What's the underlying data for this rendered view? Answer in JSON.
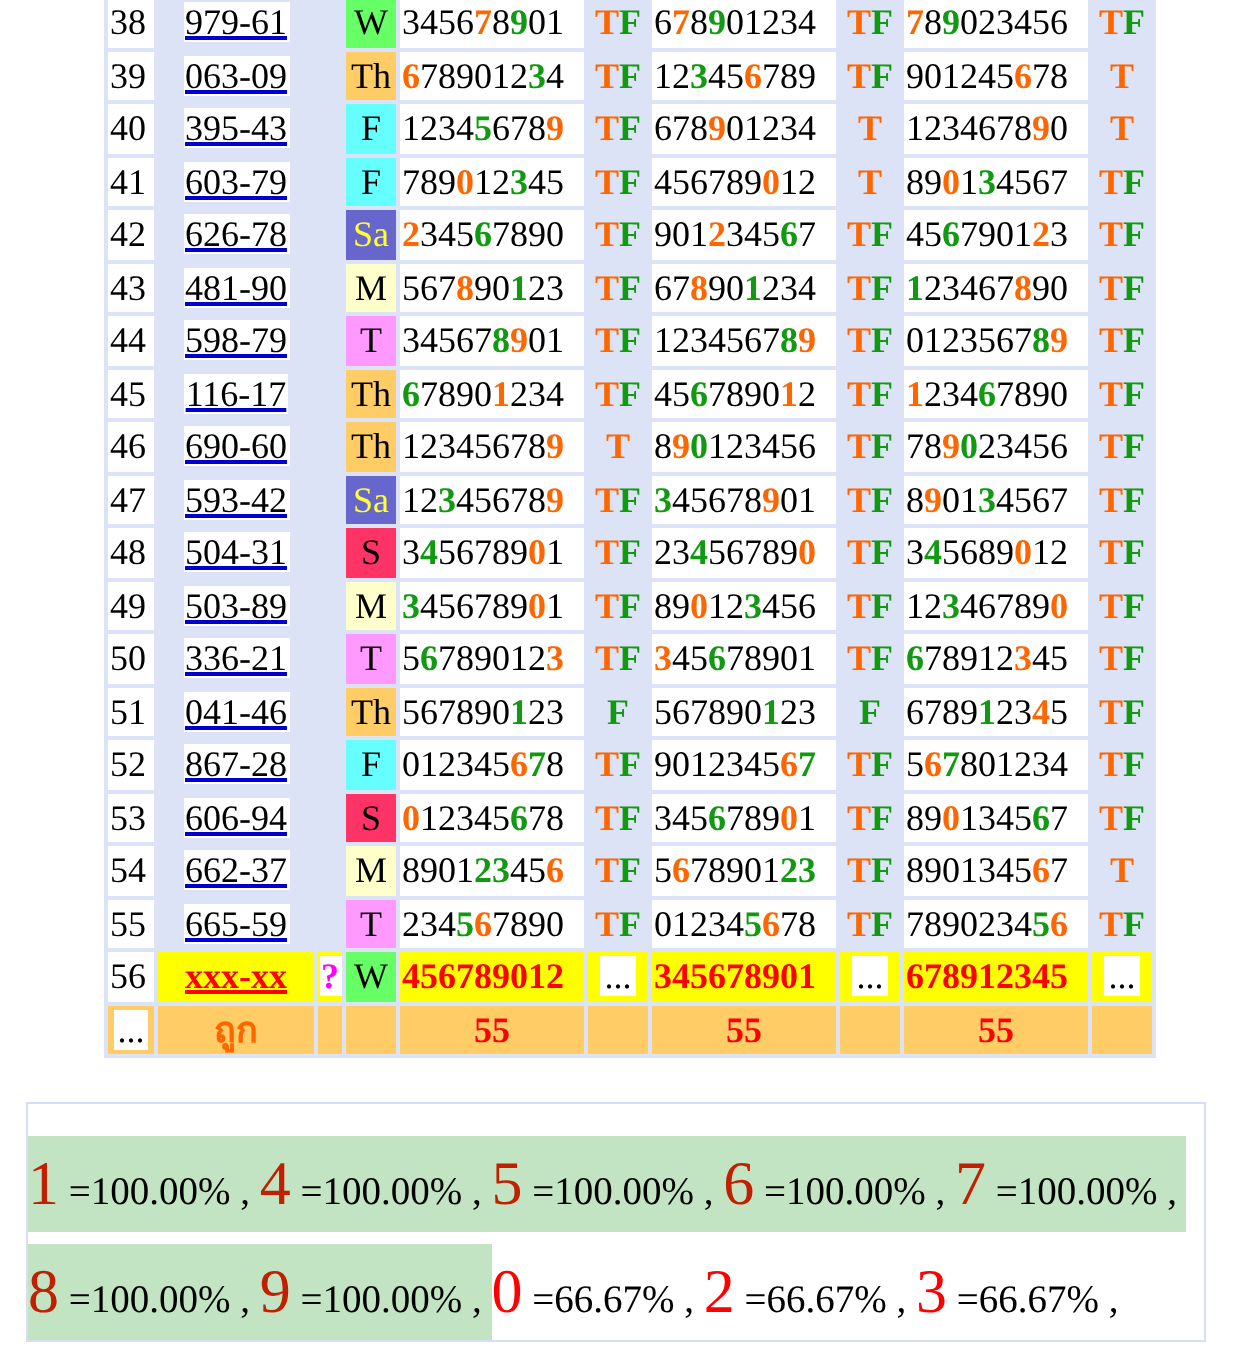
{
  "rows": [
    {
      "num": "38",
      "id": "979-61",
      "day": {
        "label": "W",
        "color": "#66ff66"
      },
      "draws": [
        {
          "digits": [
            {
              "text": "3456"
            },
            {
              "text": "7",
              "color": "#ff6600"
            },
            {
              "text": "8"
            },
            {
              "text": "9",
              "color": "#119911"
            },
            {
              "text": "01"
            }
          ],
          "result": [
            {
              "text": "T",
              "color": "#ff6600"
            },
            {
              "text": "F",
              "color": "#119911"
            }
          ]
        },
        {
          "digits": [
            {
              "text": "6"
            },
            {
              "text": "7",
              "color": "#ff6600"
            },
            {
              "text": "8"
            },
            {
              "text": "9",
              "color": "#119911"
            },
            {
              "text": "01234"
            }
          ],
          "result": [
            {
              "text": "T",
              "color": "#ff6600"
            },
            {
              "text": "F",
              "color": "#119911"
            }
          ]
        },
        {
          "digits": [
            {
              "text": "7",
              "color": "#ff6600"
            },
            {
              "text": "8"
            },
            {
              "text": "9",
              "color": "#119911"
            },
            {
              "text": "023456"
            }
          ],
          "result": [
            {
              "text": "T",
              "color": "#ff6600"
            },
            {
              "text": "F",
              "color": "#119911"
            }
          ]
        }
      ]
    },
    {
      "num": "39",
      "id": "063-09",
      "day": {
        "label": "Th",
        "color": "#ffcc66"
      },
      "draws": [
        {
          "digits": [
            {
              "text": "6",
              "color": "#ff6600"
            },
            {
              "text": "789012"
            },
            {
              "text": "3",
              "color": "#119911"
            },
            {
              "text": "4"
            }
          ],
          "result": [
            {
              "text": "T",
              "color": "#ff6600"
            },
            {
              "text": "F",
              "color": "#119911"
            }
          ]
        },
        {
          "digits": [
            {
              "text": "12"
            },
            {
              "text": "3",
              "color": "#119911"
            },
            {
              "text": "45"
            },
            {
              "text": "6",
              "color": "#ff6600"
            },
            {
              "text": "789"
            }
          ],
          "result": [
            {
              "text": "T",
              "color": "#ff6600"
            },
            {
              "text": "F",
              "color": "#119911"
            }
          ]
        },
        {
          "digits": [
            {
              "text": "901245"
            },
            {
              "text": "6",
              "color": "#ff6600"
            },
            {
              "text": "78"
            }
          ],
          "result": [
            {
              "text": "T",
              "color": "#ff6600"
            }
          ]
        }
      ]
    },
    {
      "num": "40",
      "id": "395-43",
      "day": {
        "label": "F",
        "color": "#66ffff"
      },
      "draws": [
        {
          "digits": [
            {
              "text": "1234"
            },
            {
              "text": "5",
              "color": "#119911"
            },
            {
              "text": "678"
            },
            {
              "text": "9",
              "color": "#ff6600"
            }
          ],
          "result": [
            {
              "text": "T",
              "color": "#ff6600"
            },
            {
              "text": "F",
              "color": "#119911"
            }
          ]
        },
        {
          "digits": [
            {
              "text": "678"
            },
            {
              "text": "9",
              "color": "#ff6600"
            },
            {
              "text": "01234"
            }
          ],
          "result": [
            {
              "text": "T",
              "color": "#ff6600"
            }
          ]
        },
        {
          "digits": [
            {
              "text": "1234678"
            },
            {
              "text": "9",
              "color": "#ff6600"
            },
            {
              "text": "0"
            }
          ],
          "result": [
            {
              "text": "T",
              "color": "#ff6600"
            }
          ]
        }
      ]
    },
    {
      "num": "41",
      "id": "603-79",
      "day": {
        "label": "F",
        "color": "#66ffff"
      },
      "draws": [
        {
          "digits": [
            {
              "text": "789"
            },
            {
              "text": "0",
              "color": "#ff6600"
            },
            {
              "text": "12"
            },
            {
              "text": "3",
              "color": "#119911"
            },
            {
              "text": "45"
            }
          ],
          "result": [
            {
              "text": "T",
              "color": "#ff6600"
            },
            {
              "text": "F",
              "color": "#119911"
            }
          ]
        },
        {
          "digits": [
            {
              "text": "456789"
            },
            {
              "text": "0",
              "color": "#ff6600"
            },
            {
              "text": "12"
            }
          ],
          "result": [
            {
              "text": "T",
              "color": "#ff6600"
            }
          ]
        },
        {
          "digits": [
            {
              "text": "89"
            },
            {
              "text": "0",
              "color": "#ff6600"
            },
            {
              "text": "1"
            },
            {
              "text": "3",
              "color": "#119911"
            },
            {
              "text": "4567"
            }
          ],
          "result": [
            {
              "text": "T",
              "color": "#ff6600"
            },
            {
              "text": "F",
              "color": "#119911"
            }
          ]
        }
      ]
    },
    {
      "num": "42",
      "id": "626-78",
      "day": {
        "label": "Sa",
        "color": "#6666cc"
      },
      "draws": [
        {
          "digits": [
            {
              "text": "2",
              "color": "#ff6600"
            },
            {
              "text": "345"
            },
            {
              "text": "6",
              "color": "#119911"
            },
            {
              "text": "7890"
            }
          ],
          "result": [
            {
              "text": "T",
              "color": "#ff6600"
            },
            {
              "text": "F",
              "color": "#119911"
            }
          ]
        },
        {
          "digits": [
            {
              "text": "901"
            },
            {
              "text": "2",
              "color": "#ff6600"
            },
            {
              "text": "345"
            },
            {
              "text": "6",
              "color": "#119911"
            },
            {
              "text": "7"
            }
          ],
          "result": [
            {
              "text": "T",
              "color": "#ff6600"
            },
            {
              "text": "F",
              "color": "#119911"
            }
          ]
        },
        {
          "digits": [
            {
              "text": "45"
            },
            {
              "text": "6",
              "color": "#119911"
            },
            {
              "text": "7901"
            },
            {
              "text": "2",
              "color": "#ff6600"
            },
            {
              "text": "3"
            }
          ],
          "result": [
            {
              "text": "T",
              "color": "#ff6600"
            },
            {
              "text": "F",
              "color": "#119911"
            }
          ]
        }
      ]
    },
    {
      "num": "43",
      "id": "481-90",
      "day": {
        "label": "M",
        "color": "#ffffcc"
      },
      "draws": [
        {
          "digits": [
            {
              "text": "567"
            },
            {
              "text": "8",
              "color": "#ff6600"
            },
            {
              "text": "90"
            },
            {
              "text": "1",
              "color": "#119911"
            },
            {
              "text": "23"
            }
          ],
          "result": [
            {
              "text": "T",
              "color": "#ff6600"
            },
            {
              "text": "F",
              "color": "#119911"
            }
          ]
        },
        {
          "digits": [
            {
              "text": "67"
            },
            {
              "text": "8",
              "color": "#ff6600"
            },
            {
              "text": "90"
            },
            {
              "text": "1",
              "color": "#119911"
            },
            {
              "text": "234"
            }
          ],
          "result": [
            {
              "text": "T",
              "color": "#ff6600"
            },
            {
              "text": "F",
              "color": "#119911"
            }
          ]
        },
        {
          "digits": [
            {
              "text": "1",
              "color": "#119911"
            },
            {
              "text": "23467"
            },
            {
              "text": "8",
              "color": "#ff6600"
            },
            {
              "text": "90"
            }
          ],
          "result": [
            {
              "text": "T",
              "color": "#ff6600"
            },
            {
              "text": "F",
              "color": "#119911"
            }
          ]
        }
      ]
    },
    {
      "num": "44",
      "id": "598-79",
      "day": {
        "label": "T",
        "color": "#ff99ff"
      },
      "draws": [
        {
          "digits": [
            {
              "text": "34567"
            },
            {
              "text": "8",
              "color": "#119911"
            },
            {
              "text": "9",
              "color": "#ff6600"
            },
            {
              "text": "01"
            }
          ],
          "result": [
            {
              "text": "T",
              "color": "#ff6600"
            },
            {
              "text": "F",
              "color": "#119911"
            }
          ]
        },
        {
          "digits": [
            {
              "text": "1234567"
            },
            {
              "text": "8",
              "color": "#119911"
            },
            {
              "text": "9",
              "color": "#ff6600"
            }
          ],
          "result": [
            {
              "text": "T",
              "color": "#ff6600"
            },
            {
              "text": "F",
              "color": "#119911"
            }
          ]
        },
        {
          "digits": [
            {
              "text": "0123567"
            },
            {
              "text": "8",
              "color": "#119911"
            },
            {
              "text": "9",
              "color": "#ff6600"
            }
          ],
          "result": [
            {
              "text": "T",
              "color": "#ff6600"
            },
            {
              "text": "F",
              "color": "#119911"
            }
          ]
        }
      ]
    },
    {
      "num": "45",
      "id": "116-17",
      "day": {
        "label": "Th",
        "color": "#ffcc66"
      },
      "draws": [
        {
          "digits": [
            {
              "text": "6",
              "color": "#119911"
            },
            {
              "text": "7890"
            },
            {
              "text": "1",
              "color": "#ff6600"
            },
            {
              "text": "234"
            }
          ],
          "result": [
            {
              "text": "T",
              "color": "#ff6600"
            },
            {
              "text": "F",
              "color": "#119911"
            }
          ]
        },
        {
          "digits": [
            {
              "text": "45"
            },
            {
              "text": "6",
              "color": "#119911"
            },
            {
              "text": "7890"
            },
            {
              "text": "1",
              "color": "#ff6600"
            },
            {
              "text": "2"
            }
          ],
          "result": [
            {
              "text": "T",
              "color": "#ff6600"
            },
            {
              "text": "F",
              "color": "#119911"
            }
          ]
        },
        {
          "digits": [
            {
              "text": "1",
              "color": "#ff6600"
            },
            {
              "text": "234"
            },
            {
              "text": "6",
              "color": "#119911"
            },
            {
              "text": "7890"
            }
          ],
          "result": [
            {
              "text": "T",
              "color": "#ff6600"
            },
            {
              "text": "F",
              "color": "#119911"
            }
          ]
        }
      ]
    },
    {
      "num": "46",
      "id": "690-60",
      "day": {
        "label": "Th",
        "color": "#ffcc66"
      },
      "draws": [
        {
          "digits": [
            {
              "text": "12345678"
            },
            {
              "text": "9",
              "color": "#ff6600"
            }
          ],
          "result": [
            {
              "text": "T",
              "color": "#ff6600"
            }
          ]
        },
        {
          "digits": [
            {
              "text": "8"
            },
            {
              "text": "9",
              "color": "#ff6600"
            },
            {
              "text": "0",
              "color": "#119911"
            },
            {
              "text": "123456"
            }
          ],
          "result": [
            {
              "text": "T",
              "color": "#ff6600"
            },
            {
              "text": "F",
              "color": "#119911"
            }
          ]
        },
        {
          "digits": [
            {
              "text": "78"
            },
            {
              "text": "9",
              "color": "#ff6600"
            },
            {
              "text": "0",
              "color": "#119911"
            },
            {
              "text": "23456"
            }
          ],
          "result": [
            {
              "text": "T",
              "color": "#ff6600"
            },
            {
              "text": "F",
              "color": "#119911"
            }
          ]
        }
      ]
    },
    {
      "num": "47",
      "id": "593-42",
      "day": {
        "label": "Sa",
        "color": "#6666cc"
      },
      "draws": [
        {
          "digits": [
            {
              "text": "12"
            },
            {
              "text": "3",
              "color": "#119911"
            },
            {
              "text": "45678"
            },
            {
              "text": "9",
              "color": "#ff6600"
            }
          ],
          "result": [
            {
              "text": "T",
              "color": "#ff6600"
            },
            {
              "text": "F",
              "color": "#119911"
            }
          ]
        },
        {
          "digits": [
            {
              "text": "3",
              "color": "#119911"
            },
            {
              "text": "45678"
            },
            {
              "text": "9",
              "color": "#ff6600"
            },
            {
              "text": "01"
            }
          ],
          "result": [
            {
              "text": "T",
              "color": "#ff6600"
            },
            {
              "text": "F",
              "color": "#119911"
            }
          ]
        },
        {
          "digits": [
            {
              "text": "8"
            },
            {
              "text": "9",
              "color": "#ff6600"
            },
            {
              "text": "01"
            },
            {
              "text": "3",
              "color": "#119911"
            },
            {
              "text": "4567"
            }
          ],
          "result": [
            {
              "text": "T",
              "color": "#ff6600"
            },
            {
              "text": "F",
              "color": "#119911"
            }
          ]
        }
      ]
    },
    {
      "num": "48",
      "id": "504-31",
      "day": {
        "label": "S",
        "color": "#ff3366"
      },
      "draws": [
        {
          "digits": [
            {
              "text": "3"
            },
            {
              "text": "4",
              "color": "#119911"
            },
            {
              "text": "56789"
            },
            {
              "text": "0",
              "color": "#ff6600"
            },
            {
              "text": "1"
            }
          ],
          "result": [
            {
              "text": "T",
              "color": "#ff6600"
            },
            {
              "text": "F",
              "color": "#119911"
            }
          ]
        },
        {
          "digits": [
            {
              "text": "23"
            },
            {
              "text": "4",
              "color": "#119911"
            },
            {
              "text": "56789"
            },
            {
              "text": "0",
              "color": "#ff6600"
            }
          ],
          "result": [
            {
              "text": "T",
              "color": "#ff6600"
            },
            {
              "text": "F",
              "color": "#119911"
            }
          ]
        },
        {
          "digits": [
            {
              "text": "3"
            },
            {
              "text": "4",
              "color": "#119911"
            },
            {
              "text": "5689"
            },
            {
              "text": "0",
              "color": "#ff6600"
            },
            {
              "text": "12"
            }
          ],
          "result": [
            {
              "text": "T",
              "color": "#ff6600"
            },
            {
              "text": "F",
              "color": "#119911"
            }
          ]
        }
      ]
    },
    {
      "num": "49",
      "id": "503-89",
      "day": {
        "label": "M",
        "color": "#ffffcc"
      },
      "draws": [
        {
          "digits": [
            {
              "text": "3",
              "color": "#119911"
            },
            {
              "text": "456789"
            },
            {
              "text": "0",
              "color": "#ff6600"
            },
            {
              "text": "1"
            }
          ],
          "result": [
            {
              "text": "T",
              "color": "#ff6600"
            },
            {
              "text": "F",
              "color": "#119911"
            }
          ]
        },
        {
          "digits": [
            {
              "text": "89"
            },
            {
              "text": "0",
              "color": "#ff6600"
            },
            {
              "text": "12"
            },
            {
              "text": "3",
              "color": "#119911"
            },
            {
              "text": "456"
            }
          ],
          "result": [
            {
              "text": "T",
              "color": "#ff6600"
            },
            {
              "text": "F",
              "color": "#119911"
            }
          ]
        },
        {
          "digits": [
            {
              "text": "12"
            },
            {
              "text": "3",
              "color": "#119911"
            },
            {
              "text": "46789"
            },
            {
              "text": "0",
              "color": "#ff6600"
            }
          ],
          "result": [
            {
              "text": "T",
              "color": "#ff6600"
            },
            {
              "text": "F",
              "color": "#119911"
            }
          ]
        }
      ]
    },
    {
      "num": "50",
      "id": "336-21",
      "day": {
        "label": "T",
        "color": "#ff99ff"
      },
      "draws": [
        {
          "digits": [
            {
              "text": "5"
            },
            {
              "text": "6",
              "color": "#119911"
            },
            {
              "text": "789012"
            },
            {
              "text": "3",
              "color": "#ff6600"
            }
          ],
          "result": [
            {
              "text": "T",
              "color": "#ff6600"
            },
            {
              "text": "F",
              "color": "#119911"
            }
          ]
        },
        {
          "digits": [
            {
              "text": "3",
              "color": "#ff6600"
            },
            {
              "text": "45"
            },
            {
              "text": "6",
              "color": "#119911"
            },
            {
              "text": "78901"
            }
          ],
          "result": [
            {
              "text": "T",
              "color": "#ff6600"
            },
            {
              "text": "F",
              "color": "#119911"
            }
          ]
        },
        {
          "digits": [
            {
              "text": "6",
              "color": "#119911"
            },
            {
              "text": "78912"
            },
            {
              "text": "3",
              "color": "#ff6600"
            },
            {
              "text": "45"
            }
          ],
          "result": [
            {
              "text": "T",
              "color": "#ff6600"
            },
            {
              "text": "F",
              "color": "#119911"
            }
          ]
        }
      ]
    },
    {
      "num": "51",
      "id": "041-46",
      "day": {
        "label": "Th",
        "color": "#ffcc66"
      },
      "draws": [
        {
          "digits": [
            {
              "text": "567890"
            },
            {
              "text": "1",
              "color": "#119911"
            },
            {
              "text": "23"
            }
          ],
          "result": [
            {
              "text": "F",
              "color": "#119911"
            }
          ]
        },
        {
          "digits": [
            {
              "text": "567890"
            },
            {
              "text": "1",
              "color": "#119911"
            },
            {
              "text": "23"
            }
          ],
          "result": [
            {
              "text": "F",
              "color": "#119911"
            }
          ]
        },
        {
          "digits": [
            {
              "text": "6789"
            },
            {
              "text": "1",
              "color": "#119911"
            },
            {
              "text": "23"
            },
            {
              "text": "4",
              "color": "#ff6600"
            },
            {
              "text": "5"
            }
          ],
          "result": [
            {
              "text": "T",
              "color": "#ff6600"
            },
            {
              "text": "F",
              "color": "#119911"
            }
          ]
        }
      ]
    },
    {
      "num": "52",
      "id": "867-28",
      "day": {
        "label": "F",
        "color": "#66ffff"
      },
      "draws": [
        {
          "digits": [
            {
              "text": "012345"
            },
            {
              "text": "6",
              "color": "#ff6600"
            },
            {
              "text": "7",
              "color": "#119911"
            },
            {
              "text": "8"
            }
          ],
          "result": [
            {
              "text": "T",
              "color": "#ff6600"
            },
            {
              "text": "F",
              "color": "#119911"
            }
          ]
        },
        {
          "digits": [
            {
              "text": "9012345"
            },
            {
              "text": "6",
              "color": "#ff6600"
            },
            {
              "text": "7",
              "color": "#119911"
            }
          ],
          "result": [
            {
              "text": "T",
              "color": "#ff6600"
            },
            {
              "text": "F",
              "color": "#119911"
            }
          ]
        },
        {
          "digits": [
            {
              "text": "5"
            },
            {
              "text": "6",
              "color": "#ff6600"
            },
            {
              "text": "7",
              "color": "#119911"
            },
            {
              "text": "801234"
            }
          ],
          "result": [
            {
              "text": "T",
              "color": "#ff6600"
            },
            {
              "text": "F",
              "color": "#119911"
            }
          ]
        }
      ]
    },
    {
      "num": "53",
      "id": "606-94",
      "day": {
        "label": "S",
        "color": "#ff3366"
      },
      "draws": [
        {
          "digits": [
            {
              "text": "0",
              "color": "#ff6600"
            },
            {
              "text": "12345"
            },
            {
              "text": "6",
              "color": "#119911"
            },
            {
              "text": "78"
            }
          ],
          "result": [
            {
              "text": "T",
              "color": "#ff6600"
            },
            {
              "text": "F",
              "color": "#119911"
            }
          ]
        },
        {
          "digits": [
            {
              "text": "345"
            },
            {
              "text": "6",
              "color": "#119911"
            },
            {
              "text": "789"
            },
            {
              "text": "0",
              "color": "#ff6600"
            },
            {
              "text": "1"
            }
          ],
          "result": [
            {
              "text": "T",
              "color": "#ff6600"
            },
            {
              "text": "F",
              "color": "#119911"
            }
          ]
        },
        {
          "digits": [
            {
              "text": "89"
            },
            {
              "text": "0",
              "color": "#ff6600"
            },
            {
              "text": "1345"
            },
            {
              "text": "6",
              "color": "#119911"
            },
            {
              "text": "7"
            }
          ],
          "result": [
            {
              "text": "T",
              "color": "#ff6600"
            },
            {
              "text": "F",
              "color": "#119911"
            }
          ]
        }
      ]
    },
    {
      "num": "54",
      "id": "662-37",
      "day": {
        "label": "M",
        "color": "#ffffcc"
      },
      "draws": [
        {
          "digits": [
            {
              "text": "8901"
            },
            {
              "text": "23",
              "color": "#119911"
            },
            {
              "text": "45"
            },
            {
              "text": "6",
              "color": "#ff6600"
            }
          ],
          "result": [
            {
              "text": "T",
              "color": "#ff6600"
            },
            {
              "text": "F",
              "color": "#119911"
            }
          ]
        },
        {
          "digits": [
            {
              "text": "5"
            },
            {
              "text": "6",
              "color": "#ff6600"
            },
            {
              "text": "78901"
            },
            {
              "text": "23",
              "color": "#119911"
            }
          ],
          "result": [
            {
              "text": "T",
              "color": "#ff6600"
            },
            {
              "text": "F",
              "color": "#119911"
            }
          ]
        },
        {
          "digits": [
            {
              "text": "8901345"
            },
            {
              "text": "6",
              "color": "#ff6600"
            },
            {
              "text": "7"
            }
          ],
          "result": [
            {
              "text": "T",
              "color": "#ff6600"
            }
          ]
        }
      ]
    },
    {
      "num": "55",
      "id": "665-59",
      "day": {
        "label": "T",
        "color": "#ff99ff"
      },
      "draws": [
        {
          "digits": [
            {
              "text": "234"
            },
            {
              "text": "5",
              "color": "#119911"
            },
            {
              "text": "6",
              "color": "#ff6600"
            },
            {
              "text": "7890"
            }
          ],
          "result": [
            {
              "text": "T",
              "color": "#ff6600"
            },
            {
              "text": "F",
              "color": "#119911"
            }
          ]
        },
        {
          "digits": [
            {
              "text": "01234"
            },
            {
              "text": "5",
              "color": "#119911"
            },
            {
              "text": "6",
              "color": "#ff6600"
            },
            {
              "text": "78"
            }
          ],
          "result": [
            {
              "text": "T",
              "color": "#ff6600"
            },
            {
              "text": "F",
              "color": "#119911"
            }
          ]
        },
        {
          "digits": [
            {
              "text": "7890234"
            },
            {
              "text": "5",
              "color": "#119911"
            },
            {
              "text": "6",
              "color": "#ff6600"
            }
          ],
          "result": [
            {
              "text": "T",
              "color": "#ff6600"
            },
            {
              "text": "F",
              "color": "#119911"
            }
          ]
        }
      ]
    },
    {
      "num": "56",
      "kind": "pending",
      "id": "xxx-xx",
      "flag": "?",
      "day": {
        "label": "W",
        "color": "#66ff66"
      },
      "draws": [
        {
          "digits": [
            {
              "text": "456789012"
            }
          ],
          "result": [
            {
              "text": "..."
            }
          ]
        },
        {
          "digits": [
            {
              "text": "345678901"
            }
          ],
          "result": [
            {
              "text": "..."
            }
          ]
        },
        {
          "digits": [
            {
              "text": "678912345"
            }
          ],
          "result": [
            {
              "text": "..."
            }
          ]
        }
      ]
    }
  ],
  "footer": {
    "first": "...",
    "label": "ถูก",
    "totals": [
      "55",
      "55",
      "55"
    ]
  },
  "stats": [
    {
      "digit": "1",
      "value": "=100.00% ,",
      "highlighted": true
    },
    {
      "digit": "4",
      "value": "=100.00% ,",
      "highlighted": true
    },
    {
      "digit": "5",
      "value": "=100.00% ,",
      "highlighted": true
    },
    {
      "digit": "6",
      "value": "=100.00% ,",
      "highlighted": true
    },
    {
      "digit": "7",
      "value": "=100.00% ,",
      "highlighted": true
    },
    {
      "digit": "8",
      "value": "=100.00% ,",
      "highlighted": true
    },
    {
      "digit": "9",
      "value": "=100.00% ,",
      "highlighted": true
    },
    {
      "digit": "0",
      "value": "=66.67% ,",
      "highlighted": false
    },
    {
      "digit": "2",
      "value": "=66.67% ,",
      "highlighted": false
    },
    {
      "digit": "3",
      "value": "=66.67% ,",
      "highlighted": false
    }
  ]
}
